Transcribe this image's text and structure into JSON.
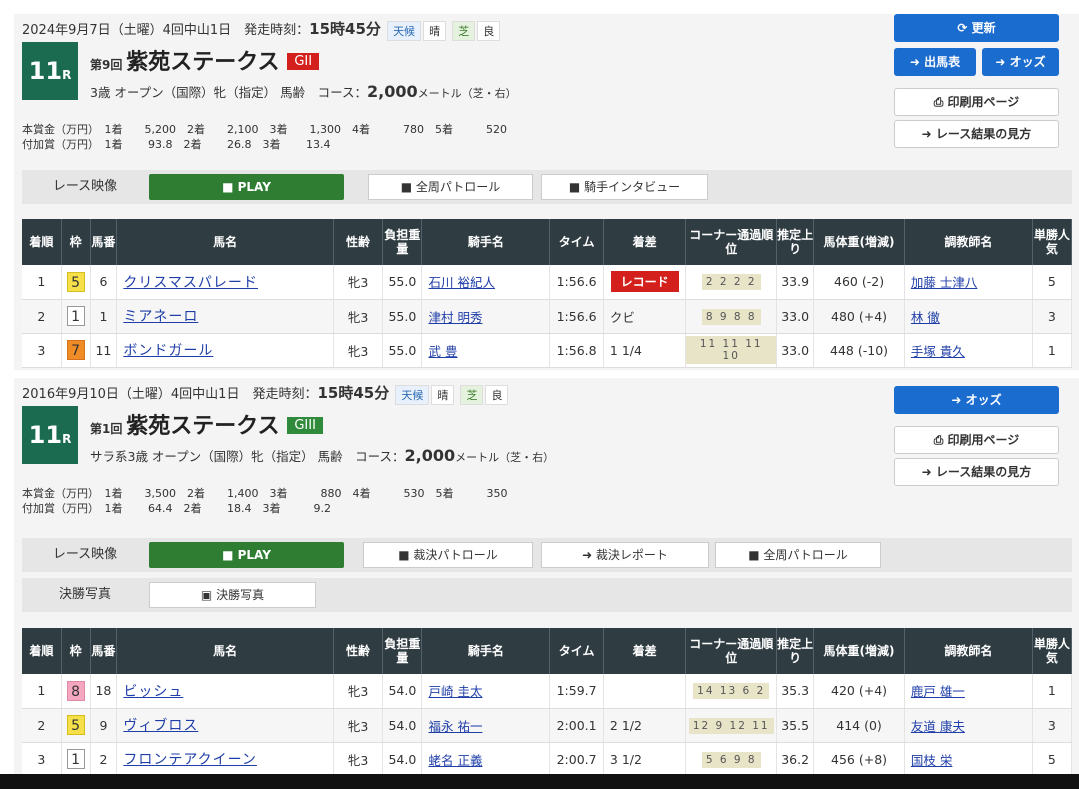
{
  "races": [
    {
      "date_prefix": "2024年9月7日（土曜）4回中山1日　発走時刻：",
      "start_time": "15時45分",
      "weather_label": "天候",
      "weather": "晴",
      "surface_label": "芝",
      "condition": "良",
      "race_no": "11",
      "race_suffix": "R",
      "kai": "第9回",
      "name": "紫苑ステークス",
      "grade": "GII",
      "conditions_text": "3歳 オープン（国際）牝（指定） 馬齢　コース：",
      "distance": "2,000",
      "distance_unit": "メートル（芝・右）",
      "prize_lines": "本賞金（万円）　1着　　5,200　2着　　2,100　3着　　1,300　4着　　　780　5着　　　520\n付加賞（万円）　1着　　 93.8　2着　　 26.8　3着　　 13.4",
      "buttons": {
        "refresh": "⟳ 更新",
        "entries": "➜ 出馬表",
        "odds": "➜ オッズ",
        "print": "⎙ 印刷用ページ",
        "howto": "➜ レース結果の見方"
      },
      "video_label": "レース映像",
      "play": "■ PLAY",
      "video_buttons": [
        "■ 全周パトロール",
        "■ 騎手インタビュー"
      ],
      "columns": [
        "着順",
        "枠",
        "馬番",
        "馬名",
        "性齢",
        "負担重量",
        "騎手名",
        "タイム",
        "着差",
        "コーナー通過順位",
        "推定上り",
        "馬体重(増減)",
        "調教師名",
        "単勝人気"
      ],
      "rows": [
        {
          "pos": "1",
          "waku": "5",
          "num": "6",
          "horse": "クリスマスパレード",
          "sex": "牝3",
          "weight": "55.0",
          "jockey": "石川 裕紀人",
          "time": "1:56.6",
          "margin": "レコード",
          "corner": "2 2 2 2",
          "last": "33.9",
          "body": "460 (-2)",
          "trainer": "加藤 士津八",
          "pop": "5"
        },
        {
          "pos": "2",
          "waku": "1",
          "num": "1",
          "horse": "ミアネーロ",
          "sex": "牝3",
          "weight": "55.0",
          "jockey": "津村 明秀",
          "time": "1:56.6",
          "margin": "クビ",
          "corner": "8 9 8 8",
          "last": "33.0",
          "body": "480 (+4)",
          "trainer": "林 徹",
          "pop": "3"
        },
        {
          "pos": "3",
          "waku": "7",
          "num": "11",
          "horse": "ボンドガール",
          "sex": "牝3",
          "weight": "55.0",
          "jockey": "武 豊",
          "time": "1:56.8",
          "margin": "1 1/4",
          "corner": "11 11 11 10",
          "last": "33.0",
          "body": "448 (-10)",
          "trainer": "手塚 貴久",
          "pop": "1"
        }
      ]
    },
    {
      "date_prefix": "2016年9月10日（土曜）4回中山1日　発走時刻：",
      "start_time": "15時45分",
      "weather_label": "天候",
      "weather": "晴",
      "surface_label": "芝",
      "condition": "良",
      "race_no": "11",
      "race_suffix": "R",
      "kai": "第1回",
      "name": "紫苑ステークス",
      "grade": "GIII",
      "conditions_text": "サラ系3歳 オープン（国際）牝（指定） 馬齢　コース：",
      "distance": "2,000",
      "distance_unit": "メートル（芝・右）",
      "prize_lines": "本賞金（万円）　1着　　3,500　2着　　1,400　3着　　　880　4着　　　530　5着　　　350\n付加賞（万円）　1着　　 64.4　2着　　 18.4　3着　　　9.2",
      "buttons": {
        "odds": "➜ オッズ",
        "print": "⎙ 印刷用ページ",
        "howto": "➜ レース結果の見方"
      },
      "video_label": "レース映像",
      "play": "■ PLAY",
      "video_buttons": [
        "■ 裁決パトロール",
        "➜ 裁決レポート",
        "■ 全周パトロール"
      ],
      "photo_label": "決勝写真",
      "photo_button": "▣ 決勝写真",
      "columns": [
        "着順",
        "枠",
        "馬番",
        "馬名",
        "性齢",
        "負担重量",
        "騎手名",
        "タイム",
        "着差",
        "コーナー通過順位",
        "推定上り",
        "馬体重(増減)",
        "調教師名",
        "単勝人気"
      ],
      "rows": [
        {
          "pos": "1",
          "waku": "8",
          "num": "18",
          "horse": "ビッシュ",
          "sex": "牝3",
          "weight": "54.0",
          "jockey": "戸崎 圭太",
          "time": "1:59.7",
          "margin": "",
          "corner": "14 13 6 2",
          "last": "35.3",
          "body": "420 (+4)",
          "trainer": "鹿戸 雄一",
          "pop": "1"
        },
        {
          "pos": "2",
          "waku": "5",
          "num": "9",
          "horse": "ヴィブロス",
          "sex": "牝3",
          "weight": "54.0",
          "jockey": "福永 祐一",
          "time": "2:00.1",
          "margin": "2 1/2",
          "corner": "12 9 12 11",
          "last": "35.5",
          "body": "414 (0)",
          "trainer": "友道 康夫",
          "pop": "3"
        },
        {
          "pos": "3",
          "waku": "1",
          "num": "2",
          "horse": "フロンテアクイーン",
          "sex": "牝3",
          "weight": "54.0",
          "jockey": "蛯名 正義",
          "time": "2:00.7",
          "margin": "3 1/2",
          "corner": "5 6 9 8",
          "last": "36.2",
          "body": "456 (+8)",
          "trainer": "国枝 栄",
          "pop": "5"
        }
      ]
    }
  ]
}
